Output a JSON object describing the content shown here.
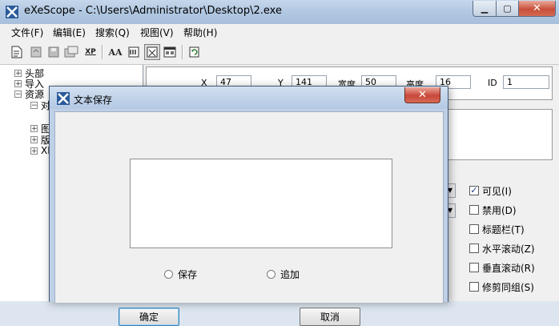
{
  "window": {
    "title": "eXeScope - C:\\Users\\Administrator\\Desktop\\2.exe",
    "minimize_glyph": "▁",
    "maximize_glyph": "▢",
    "close_glyph": "✕"
  },
  "menu": [
    "文件(F)",
    "编辑(E)",
    "搜索(Q)",
    "视图(V)",
    "帮助(H)"
  ],
  "toolbar": {
    "icons": [
      "new-file-icon",
      "open-icon",
      "save-icon",
      "export-icon",
      "xp-style-icon",
      "font-icon",
      "image-icon",
      "dialog-editor-icon",
      "form-icon",
      "refresh-icon"
    ],
    "xp_label": "XP",
    "font_label": "AA"
  },
  "tree": {
    "items": [
      {
        "label": "头部",
        "expander": "+"
      },
      {
        "label": "导入",
        "expander": "+"
      },
      {
        "label": "资源",
        "expander": "−"
      },
      {
        "label": "对",
        "expander": "−"
      },
      {
        "label": "图",
        "expander": "+"
      },
      {
        "label": "版",
        "expander": "+"
      },
      {
        "label": "XI",
        "expander": "+"
      }
    ]
  },
  "properties": {
    "x_label": "X",
    "x_value": "47",
    "y_label": "Y",
    "y_value": "141",
    "width_label": "宽度",
    "width_value": "50",
    "height_label": "高度",
    "height_value": "16",
    "id_label": "ID",
    "id_value": "1"
  },
  "checkboxes": [
    {
      "label": "可见(I)",
      "checked": true,
      "mark": "✓"
    },
    {
      "label": "禁用(D)",
      "checked": false,
      "mark": ""
    },
    {
      "label": "标题栏(T)",
      "checked": false,
      "mark": ""
    },
    {
      "label": "水平滚动(Z)",
      "checked": false,
      "mark": ""
    },
    {
      "label": "垂直滚动(R)",
      "checked": false,
      "mark": ""
    },
    {
      "label": "修剪同组(S)",
      "checked": false,
      "mark": ""
    }
  ],
  "dropdown_arrow_glyph": "▼",
  "dialog": {
    "title": "文本保存",
    "close_glyph": "✕",
    "textarea_value": "",
    "radio_save": "保存",
    "radio_append": "追加",
    "ok_label": "确定",
    "cancel_label": "取消"
  },
  "colors": {
    "titlebar": "#b3c9e2",
    "close_button": "#c8503a",
    "window_bg": "#f0f0f0"
  }
}
